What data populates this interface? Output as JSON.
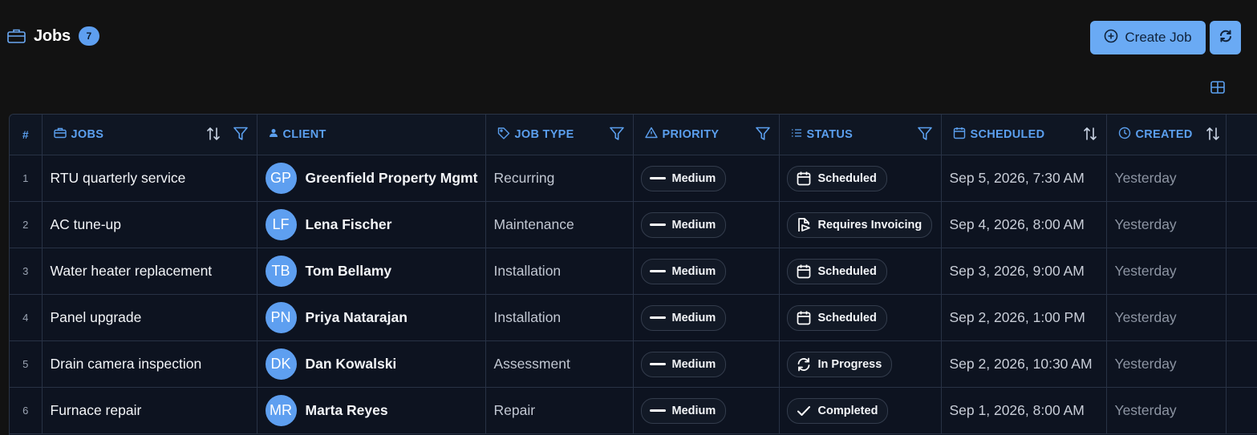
{
  "header": {
    "title": "Jobs",
    "count": "7",
    "icon": "briefcase-icon",
    "create_label": "Create Job"
  },
  "colors": {
    "accent": "#5e9ff0",
    "background": "#121212",
    "table_background": "#0d1320"
  },
  "columns": {
    "number": "#",
    "jobs": "JOBS",
    "client": "CLIENT",
    "job_type": "JOB TYPE",
    "priority": "PRIORITY",
    "status": "STATUS",
    "scheduled": "SCHEDULED",
    "created": "CREATED"
  },
  "rows": [
    {
      "num": "1",
      "job": "RTU quarterly service",
      "initials": "GP",
      "client": "Greenfield Property Mgmt",
      "type": "Recurring",
      "priority": "Medium",
      "status": "Scheduled",
      "status_icon": "calendar-icon",
      "scheduled": "Sep 5, 2026, 7:30 AM",
      "created": "Yesterday"
    },
    {
      "num": "2",
      "job": "AC tune-up",
      "initials": "LF",
      "client": "Lena Fischer",
      "type": "Maintenance",
      "priority": "Medium",
      "status": "Requires Invoicing",
      "status_icon": "invoice-icon",
      "scheduled": "Sep 4, 2026, 8:00 AM",
      "created": "Yesterday"
    },
    {
      "num": "3",
      "job": "Water heater replacement",
      "initials": "TB",
      "client": "Tom Bellamy",
      "type": "Installation",
      "priority": "Medium",
      "status": "Scheduled",
      "status_icon": "calendar-icon",
      "scheduled": "Sep 3, 2026, 9:00 AM",
      "created": "Yesterday"
    },
    {
      "num": "4",
      "job": "Panel upgrade",
      "initials": "PN",
      "client": "Priya Natarajan",
      "type": "Installation",
      "priority": "Medium",
      "status": "Scheduled",
      "status_icon": "calendar-icon",
      "scheduled": "Sep 2, 2026, 1:00 PM",
      "created": "Yesterday"
    },
    {
      "num": "5",
      "job": "Drain camera inspection",
      "initials": "DK",
      "client": "Dan Kowalski",
      "type": "Assessment",
      "priority": "Medium",
      "status": "In Progress",
      "status_icon": "refresh-icon",
      "scheduled": "Sep 2, 2026, 10:30 AM",
      "created": "Yesterday"
    },
    {
      "num": "6",
      "job": "Furnace repair",
      "initials": "MR",
      "client": "Marta Reyes",
      "type": "Repair",
      "priority": "Medium",
      "status": "Completed",
      "status_icon": "check-icon",
      "scheduled": "Sep 1, 2026, 8:00 AM",
      "created": "Yesterday"
    }
  ]
}
